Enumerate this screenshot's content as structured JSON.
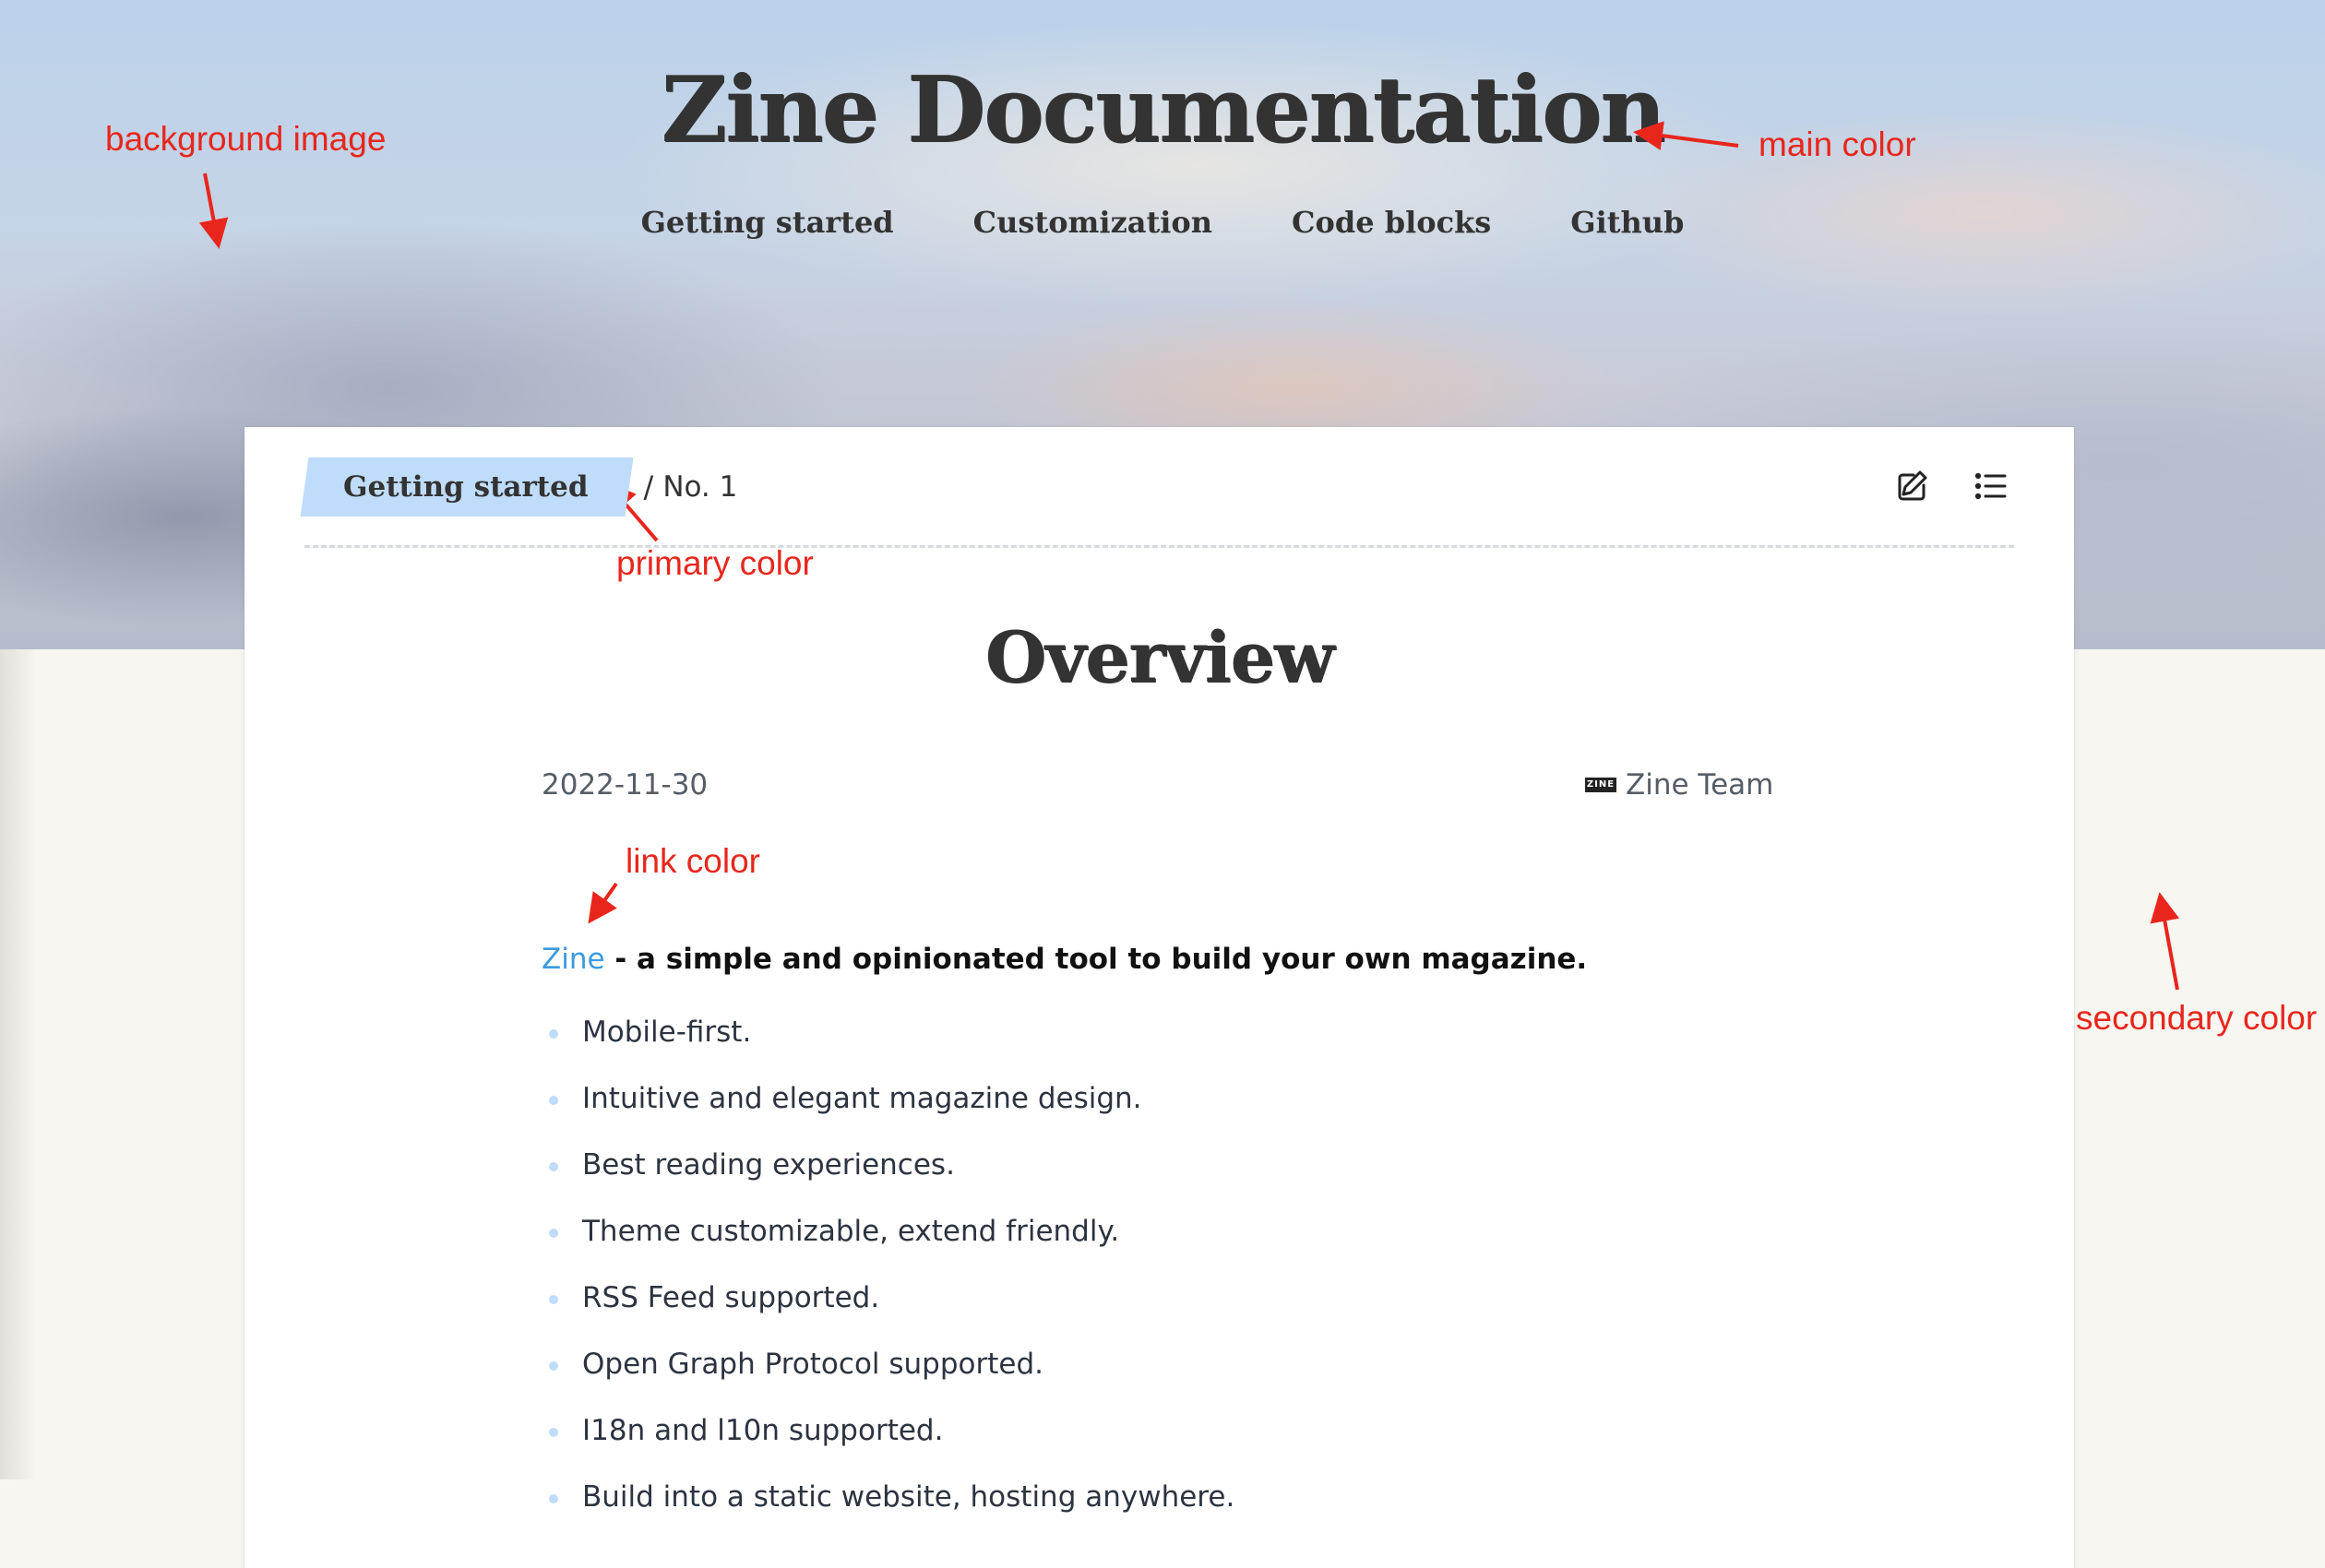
{
  "site": {
    "title": "Zine Documentation",
    "nav": [
      "Getting started",
      "Customization",
      "Code blocks",
      "Github"
    ]
  },
  "article": {
    "breadcrumb_section": "Getting started",
    "breadcrumb_separator": "/",
    "breadcrumb_number": "No. 1",
    "title": "Overview",
    "date": "2022-11-30",
    "author": "Zine Team",
    "logo_text": "ZINE",
    "lead_link": "Zine",
    "lead_text": " - a simple and opinionated tool to build your own magazine.",
    "features": [
      "Mobile-first.",
      "Intuitive and elegant magazine design.",
      "Best reading experiences.",
      "Theme customizable, extend friendly.",
      "RSS Feed supported.",
      "Open Graph Protocol supported.",
      "I18n and l10n supported.",
      "Build into a static website, hosting anywhere."
    ]
  },
  "annotations": {
    "background_image": "background image",
    "main_color": "main color",
    "primary_color": "primary color",
    "link_color": "link color",
    "secondary_color": "secondary color"
  },
  "icons": {
    "edit": "edit-icon",
    "toc": "toc-list-icon"
  },
  "colors": {
    "main": "#333333",
    "primary": "#bfdcfb",
    "link": "#3b9ae1",
    "secondary": "#f7f6f1",
    "annotation": "#e8261c"
  }
}
